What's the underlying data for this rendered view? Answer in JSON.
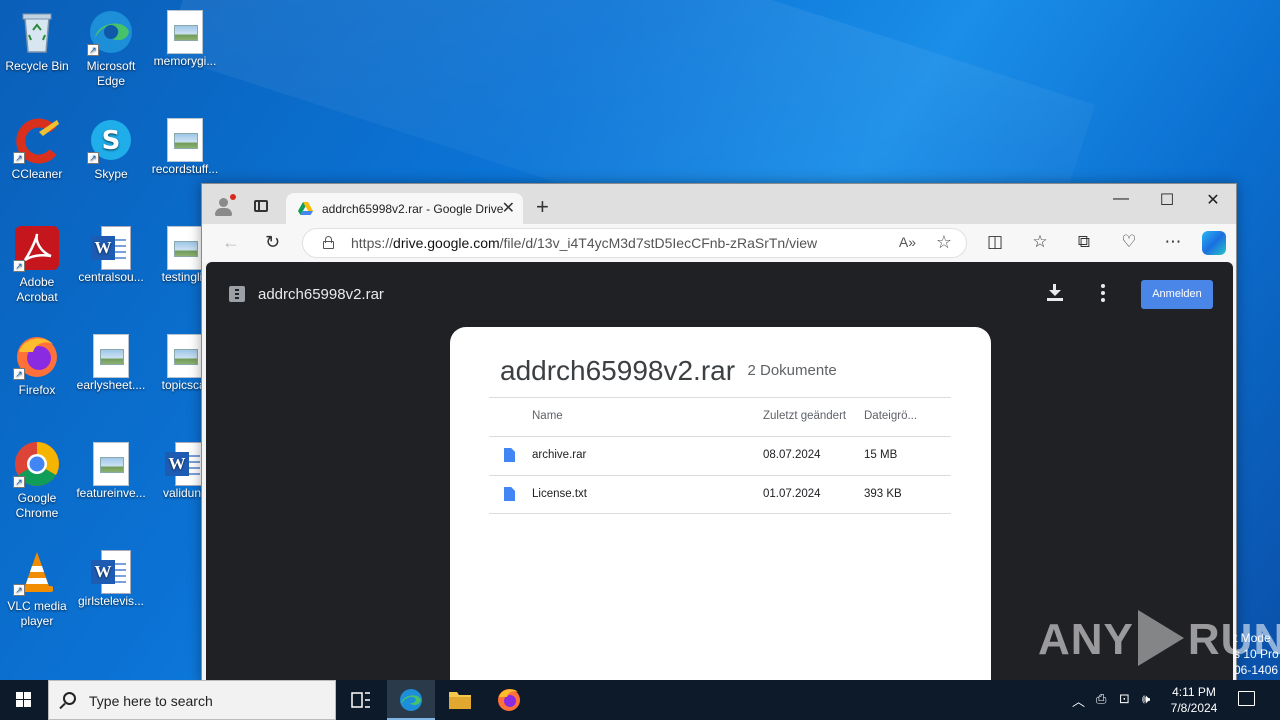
{
  "desktop": {
    "icons": [
      {
        "label": "Recycle Bin"
      },
      {
        "label": "Microsoft Edge"
      },
      {
        "label": "memorygi..."
      },
      {
        "label": "CCleaner"
      },
      {
        "label": "Skype"
      },
      {
        "label": "recordstuff..."
      },
      {
        "label": "Adobe Acrobat"
      },
      {
        "label": "centralsou..."
      },
      {
        "label": "testinglis"
      },
      {
        "label": "Firefox"
      },
      {
        "label": "earlysheet...."
      },
      {
        "label": "topicscal"
      },
      {
        "label": "Google Chrome"
      },
      {
        "label": "featureinve..."
      },
      {
        "label": "validunti"
      },
      {
        "label": "VLC media player"
      },
      {
        "label": "girlstelevis..."
      }
    ]
  },
  "browser": {
    "tab_title": "addrch65998v2.rar - Google Drive",
    "url_prefix": "https://",
    "url_host": "drive.google.com",
    "url_path": "/file/d/13v_i4T4ycM3d7stD5IecCFnb-zRaSrTn/view",
    "window_controls": {
      "minimize": "—",
      "maximize": "☐",
      "close": "✕"
    }
  },
  "viewer": {
    "file_title": "addrch65998v2.rar",
    "signin_label": "Anmelden",
    "card": {
      "title": "addrch65998v2.rar",
      "count": "2 Dokumente",
      "columns": {
        "name": "Name",
        "modified": "Zuletzt geändert",
        "size": "Dateigrö..."
      },
      "rows": [
        {
          "name": "archive.rar",
          "modified": "08.07.2024",
          "size": "15 MB"
        },
        {
          "name": "License.txt",
          "modified": "01.07.2024",
          "size": "393 KB"
        }
      ]
    }
  },
  "watermark": {
    "left": "ANY",
    "right": "RUN"
  },
  "test_mode": {
    "line1": "t Mode",
    "line2": "s 10 Pro",
    "line3": "06-1406"
  },
  "taskbar": {
    "search_placeholder": "Type here to search",
    "time": "4:11 PM",
    "date": "7/8/2024"
  },
  "colors": {
    "accent": "#4a86e8",
    "viewer_bg": "#202124",
    "taskbar": "#0c1a2a"
  }
}
